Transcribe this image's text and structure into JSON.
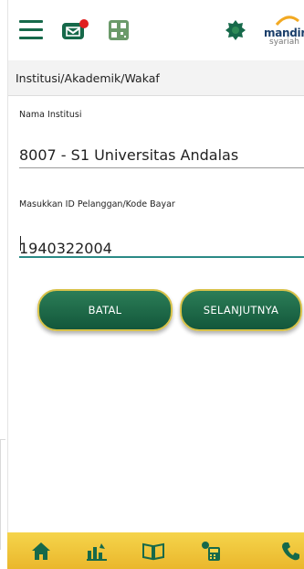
{
  "header": {
    "logo_word": "mandiri",
    "logo_sub": "syariah",
    "qr_text": "QR"
  },
  "section": {
    "title": "Institusi/Akademik/Wakaf"
  },
  "form": {
    "institution_label": "Nama Institusi",
    "institution_value": "8007 - S1 Universitas Andalas",
    "customer_label": "Masukkan ID Pelanggan/Kode Bayar",
    "customer_value": "1940322004"
  },
  "buttons": {
    "cancel": "BATAL",
    "next": "SELANJUTNYA"
  },
  "colors": {
    "primary": "#16694a",
    "accent_yellow": "#eab72c",
    "focus": "#2a8a86",
    "notification": "#e02020"
  },
  "bottom_nav": [
    "home-icon",
    "chart-icon",
    "book-icon",
    "calculator-icon",
    "phone-icon"
  ]
}
